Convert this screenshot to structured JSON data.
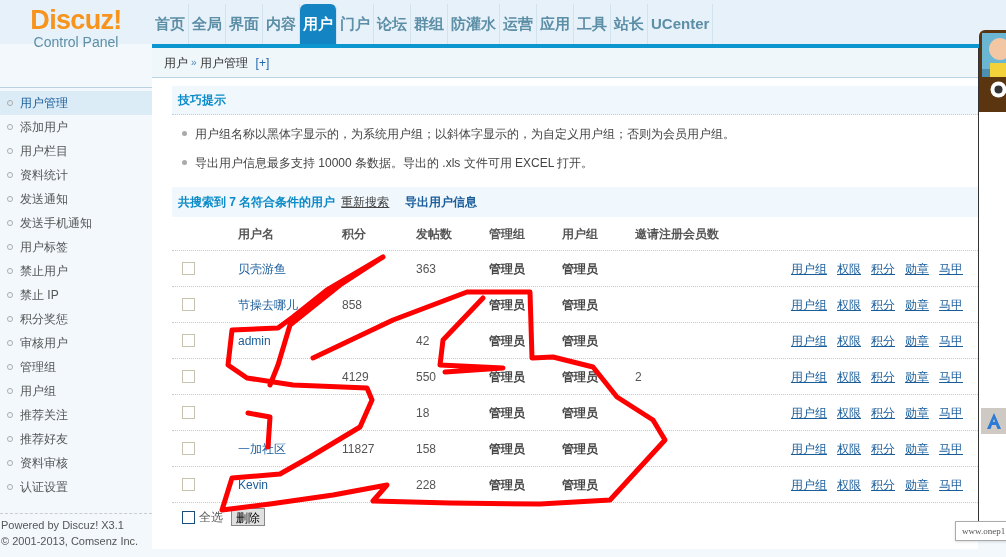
{
  "logo": {
    "title": "Discuz!",
    "subtitle": "Control Panel"
  },
  "nav": [
    {
      "label": "首页",
      "selected": false
    },
    {
      "label": "全局",
      "selected": false
    },
    {
      "label": "界面",
      "selected": false
    },
    {
      "label": "内容",
      "selected": false
    },
    {
      "label": "用户",
      "selected": true
    },
    {
      "label": "门户",
      "selected": false
    },
    {
      "label": "论坛",
      "selected": false
    },
    {
      "label": "群组",
      "selected": false
    },
    {
      "label": "防灌水",
      "selected": false
    },
    {
      "label": "运营",
      "selected": false
    },
    {
      "label": "应用",
      "selected": false
    },
    {
      "label": "工具",
      "selected": false
    },
    {
      "label": "站长",
      "selected": false
    },
    {
      "label": "UCenter",
      "selected": false
    }
  ],
  "breadcrumb": {
    "section": "用户",
    "separator": "»",
    "page": "用户管理",
    "add": "[+]"
  },
  "sidebar": {
    "items": [
      {
        "label": "用户管理",
        "selected": true
      },
      {
        "label": "添加用户",
        "selected": false
      },
      {
        "label": "用户栏目",
        "selected": false
      },
      {
        "label": "资料统计",
        "selected": false
      },
      {
        "label": "发送通知",
        "selected": false
      },
      {
        "label": "发送手机通知",
        "selected": false
      },
      {
        "label": "用户标签",
        "selected": false
      },
      {
        "label": "禁止用户",
        "selected": false
      },
      {
        "label": "禁止 IP",
        "selected": false
      },
      {
        "label": "积分奖惩",
        "selected": false
      },
      {
        "label": "审核用户",
        "selected": false
      },
      {
        "label": "管理组",
        "selected": false
      },
      {
        "label": "用户组",
        "selected": false
      },
      {
        "label": "推荐关注",
        "selected": false
      },
      {
        "label": "推荐好友",
        "selected": false
      },
      {
        "label": "资料审核",
        "selected": false
      },
      {
        "label": "认证设置",
        "selected": false
      }
    ],
    "footer": [
      "Powered by Discuz! X3.1",
      "© 2001-2013, Comsenz Inc."
    ]
  },
  "tips": {
    "title": "技巧提示",
    "items": [
      "用户组名称以黑体字显示的，为系统用户组；以斜体字显示的，为自定义用户组；否则为会员用户组。",
      "导出用户信息最多支持 10000 条数据。导出的 .xls 文件可用 EXCEL 打开。"
    ]
  },
  "summary": {
    "text": "共搜索到 7 名符合条件的用户",
    "research": "重新搜索",
    "export": "导出用户信息"
  },
  "table": {
    "columns": [
      "用户名",
      "积分",
      "发帖数",
      "管理组",
      "用户组",
      "邀请注册会员数"
    ],
    "rows": [
      {
        "checked": false,
        "name": "贝壳游鱼",
        "posts": "363",
        "admin_group": "管理员",
        "user_group": "管理员",
        "actions": [
          "用户组",
          "权限",
          "积分",
          "勋章",
          "马甲"
        ]
      },
      {
        "checked": false,
        "name": "节操去哪儿",
        "points": "858",
        "admin_group": "管理员",
        "user_group": "管理员",
        "actions": [
          "用户组",
          "权限",
          "积分",
          "勋章",
          "马甲"
        ]
      },
      {
        "checked": false,
        "name": "admin",
        "posts": "42",
        "admin_group": "管理员",
        "user_group": "管理员",
        "actions": [
          "用户组",
          "权限",
          "积分",
          "勋章",
          "马甲"
        ]
      },
      {
        "checked": false,
        "points": "4129",
        "posts": "550",
        "admin_group": "管理员",
        "user_group": "管理员",
        "invites": "2",
        "actions": [
          "用户组",
          "权限",
          "积分",
          "勋章",
          "马甲"
        ]
      },
      {
        "checked": false,
        "posts": "18",
        "admin_group": "管理员",
        "user_group": "管理员",
        "actions": [
          "用户组",
          "权限",
          "积分",
          "勋章",
          "马甲"
        ]
      },
      {
        "checked": false,
        "name": "一加社区",
        "points": "11827",
        "posts": "158",
        "admin_group": "管理员",
        "user_group": "管理员",
        "actions": [
          "用户组",
          "权限",
          "积分",
          "勋章",
          "马甲"
        ]
      },
      {
        "checked": false,
        "name": "Kevin",
        "posts": "228",
        "admin_group": "管理员",
        "user_group": "管理员",
        "actions": [
          "用户组",
          "权限",
          "积分",
          "勋章",
          "马甲"
        ]
      }
    ]
  },
  "select_all": {
    "label": "全选",
    "checked": false
  },
  "delete_button": "删除",
  "tooltip": "www.onep1"
}
